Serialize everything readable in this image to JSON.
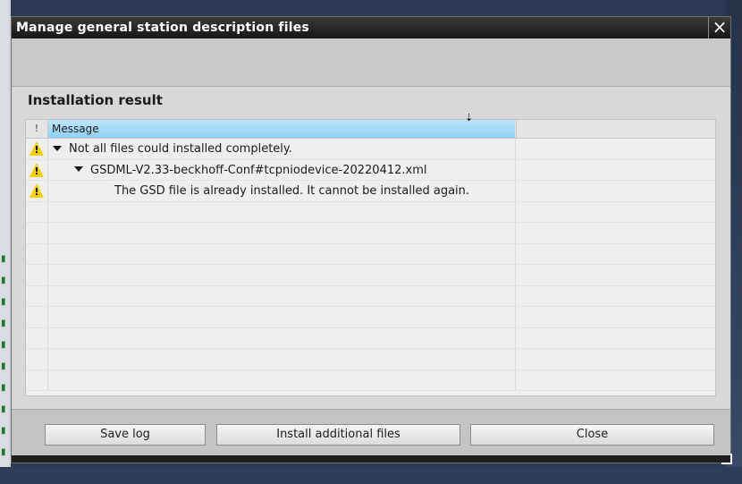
{
  "dialog": {
    "title": "Manage general station description files",
    "close_icon": "×"
  },
  "section": {
    "title": "Installation result"
  },
  "grid": {
    "columns": {
      "flag": "!",
      "message": "Message"
    },
    "rows": [
      {
        "icon": "warning-icon",
        "expander": "expanded",
        "text": "Not all files could installed completely."
      },
      {
        "icon": "warning-icon",
        "expander": "expanded",
        "text": "GSDML-V2.33-beckhoff-Conf#tcpniodevice-20220412.xml"
      },
      {
        "icon": "warning-icon",
        "expander": "none",
        "text": "The GSD file is already installed. It cannot be installed again."
      }
    ]
  },
  "footer": {
    "save_log_label": "Save log",
    "install_additional_label": "Install additional files",
    "close_label": "Close"
  },
  "colors": {
    "title_bar": "#161616",
    "header_highlight": "#8ed0f3",
    "warning": "#f5d000"
  }
}
